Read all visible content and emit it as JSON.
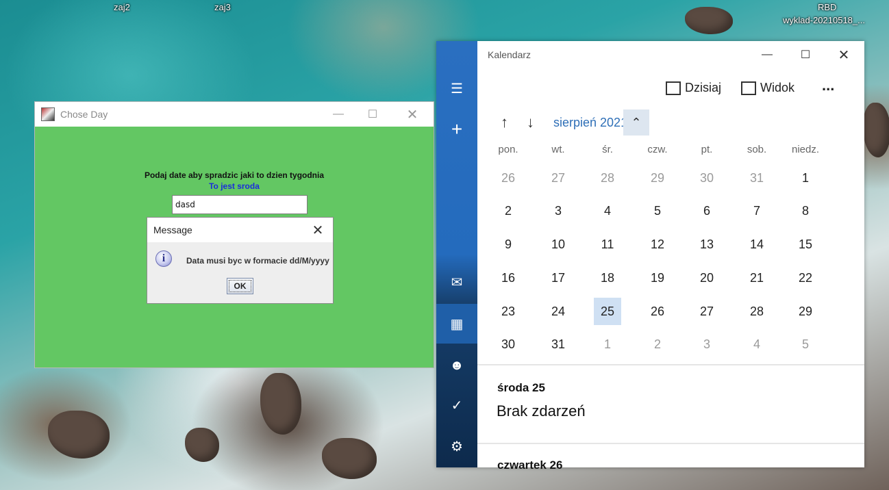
{
  "desktop": {
    "icons": [
      "zaj2",
      "zaj3",
      "RBD",
      "wyklad-20210518_..."
    ]
  },
  "java_window": {
    "title": "Chose Day",
    "prompt": "Podaj date aby spradzic jaki to dzien tygodnia",
    "result": "To jest sroda",
    "input_value": "dasd",
    "content_bg": "#63c763"
  },
  "message_dialog": {
    "title": "Message",
    "text": "Data musi byc w formacie dd/M/yyyy",
    "ok_label": "OK",
    "icon": "info-icon"
  },
  "calendar_app": {
    "title": "Kalendarz",
    "toolbar": {
      "today_label": "Dzisiaj",
      "view_label": "Widok",
      "more": "..."
    },
    "month_label": "sierpień 2021",
    "weekdays": [
      "pon.",
      "wt.",
      "śr.",
      "czw.",
      "pt.",
      "sob.",
      "niedz."
    ],
    "weeks": [
      [
        "26",
        "27",
        "28",
        "29",
        "30",
        "31",
        "1"
      ],
      [
        "2",
        "3",
        "4",
        "5",
        "6",
        "7",
        "8"
      ],
      [
        "9",
        "10",
        "11",
        "12",
        "13",
        "14",
        "15"
      ],
      [
        "16",
        "17",
        "18",
        "19",
        "20",
        "21",
        "22"
      ],
      [
        "23",
        "24",
        "25",
        "26",
        "27",
        "28",
        "29"
      ],
      [
        "30",
        "31",
        "1",
        "2",
        "3",
        "4",
        "5"
      ]
    ],
    "selected_day": "25",
    "agenda": [
      {
        "day": "środa 25",
        "text": "Brak zdarzeń"
      },
      {
        "day": "czwartek 26"
      }
    ],
    "rail_icons": [
      "hamburger-icon",
      "plus-icon",
      "mail-icon",
      "calendar-icon",
      "people-icon",
      "todo-icon",
      "settings-icon"
    ],
    "accent": "#2e6fb7"
  }
}
